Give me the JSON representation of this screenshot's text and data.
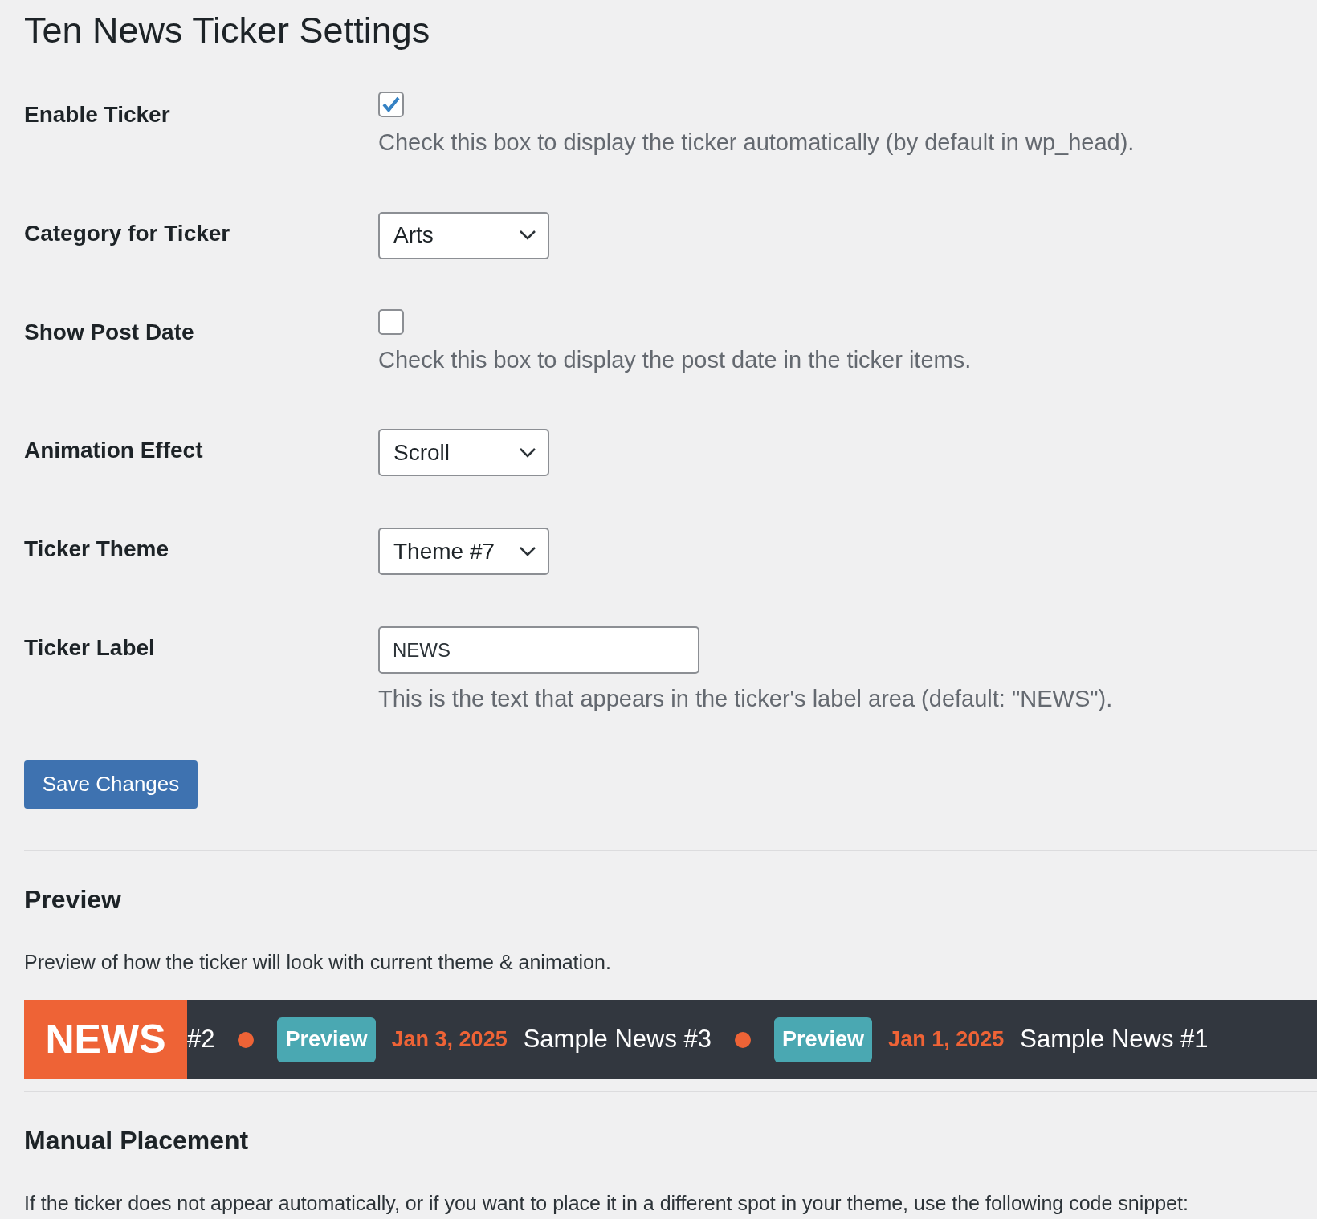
{
  "title": "Ten News Ticker Settings",
  "fields": [
    {
      "kind": "checkbox",
      "label": "Enable Ticker",
      "checked": true,
      "description": "Check this box to display the ticker automatically (by default in wp_head)."
    },
    {
      "kind": "select",
      "label": "Category for Ticker",
      "value": "Arts"
    },
    {
      "kind": "checkbox",
      "label": "Show Post Date",
      "checked": false,
      "description": "Check this box to display the post date in the ticker items."
    },
    {
      "kind": "select",
      "label": "Animation Effect",
      "value": "Scroll"
    },
    {
      "kind": "select",
      "label": "Ticker Theme",
      "value": "Theme #7"
    },
    {
      "kind": "text",
      "label": "Ticker Label",
      "value": "NEWS",
      "description": "This is the text that appears in the ticker's label area (default: \"NEWS\")."
    }
  ],
  "save_button": "Save Changes",
  "preview": {
    "heading": "Preview",
    "description": "Preview of how the ticker will look with current theme & animation.",
    "ticker_label": "NEWS",
    "items": [
      {
        "kind": "headline",
        "text": "#2"
      },
      {
        "kind": "separator"
      },
      {
        "kind": "badge",
        "text": "Preview"
      },
      {
        "kind": "date",
        "text": "Jan 3, 2025"
      },
      {
        "kind": "headline",
        "text": "Sample News #3"
      },
      {
        "kind": "separator"
      },
      {
        "kind": "badge",
        "text": "Preview"
      },
      {
        "kind": "date",
        "text": "Jan 1, 2025"
      },
      {
        "kind": "headline",
        "text": "Sample News #1"
      }
    ]
  },
  "manual": {
    "heading": "Manual Placement",
    "description": "If the ticker does not appear automatically, or if you want to place it in a different spot in your theme, use the following code snippet:"
  }
}
